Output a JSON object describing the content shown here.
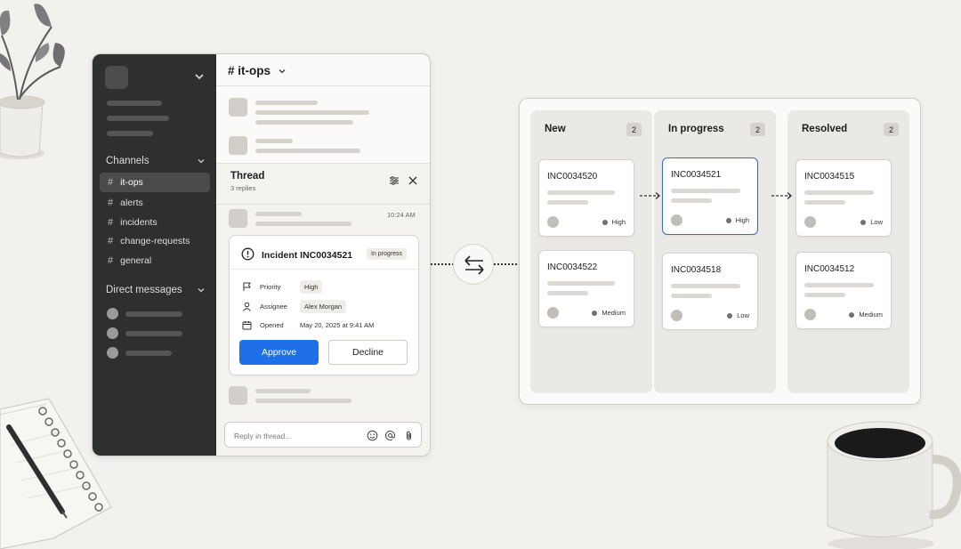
{
  "slack": {
    "channels_header": "Channels",
    "channels": [
      {
        "hash": "#",
        "label": "it-ops"
      },
      {
        "hash": "#",
        "label": "alerts"
      },
      {
        "hash": "#",
        "label": "incidents"
      },
      {
        "hash": "#",
        "label": "change-requests"
      },
      {
        "hash": "#",
        "label": "general"
      }
    ],
    "dm_header": "Direct messages",
    "channel_title": "# it-ops",
    "thread": {
      "title": "Thread",
      "replies": "3 replies",
      "time": "10:24 AM",
      "reply_placeholder": "Reply in thread..."
    },
    "incident": {
      "title": "Incident INC0034521",
      "status": "In progress",
      "rows": [
        {
          "label": "Priority",
          "value": "High",
          "icon": "flag-icon"
        },
        {
          "label": "Assignee",
          "value": "Alex Morgan",
          "icon": "user-icon"
        },
        {
          "label": "Opened",
          "value": "May 20, 2025 at 9:41 AM",
          "icon": "calendar-icon"
        }
      ],
      "approve": "Approve",
      "decline": "Decline"
    }
  },
  "kanban": {
    "columns": [
      {
        "title": "New",
        "count": "2",
        "cards": [
          {
            "id": "INC0034520",
            "priority": "High"
          },
          {
            "id": "INC0034522",
            "priority": "Medium"
          }
        ]
      },
      {
        "title": "In progress",
        "count": "2",
        "cards": [
          {
            "id": "INC0034521",
            "priority": "High"
          },
          {
            "id": "INC0034518",
            "priority": "Low"
          }
        ]
      },
      {
        "title": "Resolved",
        "count": "2",
        "cards": [
          {
            "id": "INC0034515",
            "priority": "Low"
          },
          {
            "id": "INC0034512",
            "priority": "Medium"
          }
        ]
      }
    ]
  },
  "colors": {
    "accent": "#1f6fe8",
    "sidebar": "#2f2f2f",
    "background": "#f3f1ee"
  }
}
